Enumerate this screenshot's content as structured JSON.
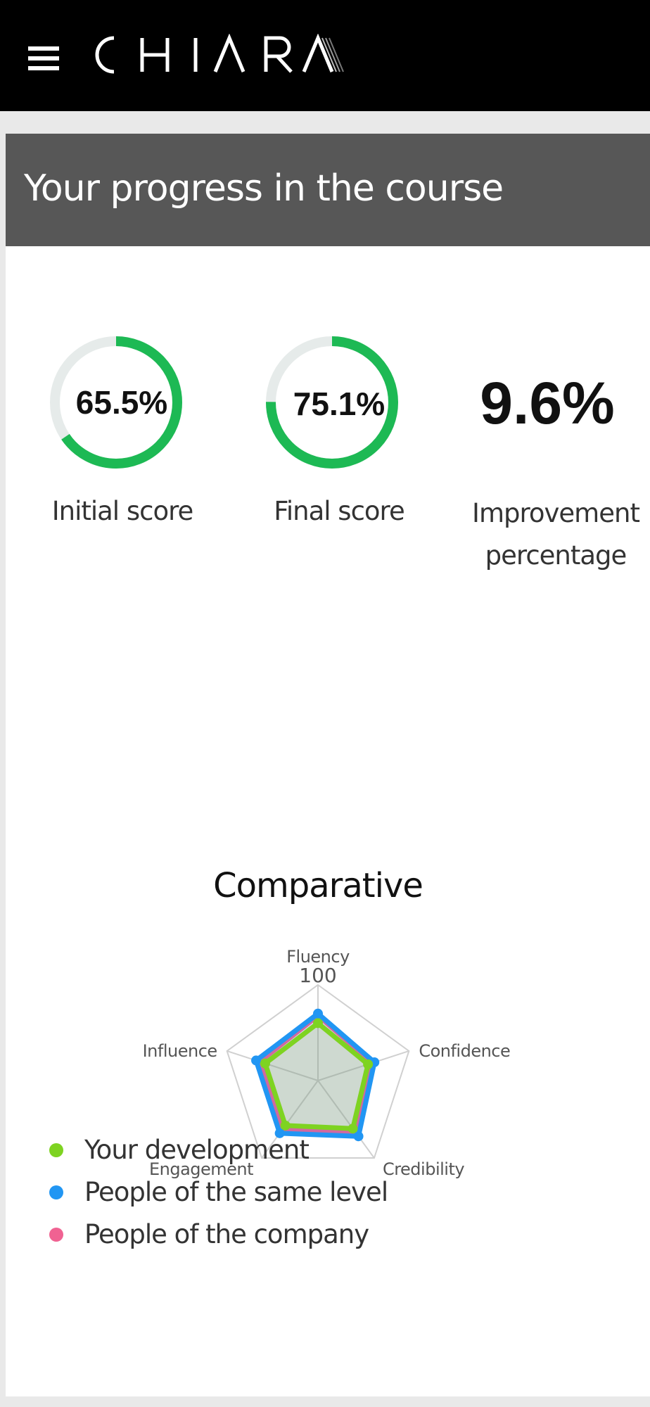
{
  "app": {
    "logo_text": "CHIARA",
    "menu_icon": "hamburger-menu-icon"
  },
  "header": {
    "title": "Your progress in the course"
  },
  "metrics": {
    "initial": {
      "value_text": "65.5%",
      "value": 65.5,
      "label": "Initial score"
    },
    "final": {
      "value_text": "75.1%",
      "value": 75.1,
      "label": "Final score"
    },
    "improvement": {
      "value_text": "9.6%",
      "label_line1": "Improvement",
      "label_line2": "percentage"
    }
  },
  "colors": {
    "accent_green": "#1db954",
    "ring_track": "#e6ebea",
    "header_bg": "#575757",
    "series_green": "#7ed321",
    "series_blue": "#2196f3",
    "series_pink": "#f06292"
  },
  "chart_data": {
    "type": "radar",
    "title": "Comparative",
    "axes": [
      "Fluency",
      "Confidence",
      "Credibility",
      "Engagement",
      "Influence"
    ],
    "scale_max": 100,
    "scale_max_label": "100",
    "series": [
      {
        "name": "People of the company",
        "color": "#f06292",
        "values": [
          68,
          60,
          66,
          62,
          64
        ]
      },
      {
        "name": "People of the same level",
        "color": "#2196f3",
        "values": [
          70,
          62,
          72,
          68,
          68
        ]
      },
      {
        "name": "Your development",
        "color": "#7ed321",
        "values": [
          60,
          55,
          62,
          58,
          58
        ]
      }
    ]
  },
  "legend": [
    {
      "label": "Your development",
      "color": "#7ed321"
    },
    {
      "label": "People of the same level",
      "color": "#2196f3"
    },
    {
      "label": "People of the company",
      "color": "#f06292"
    }
  ]
}
